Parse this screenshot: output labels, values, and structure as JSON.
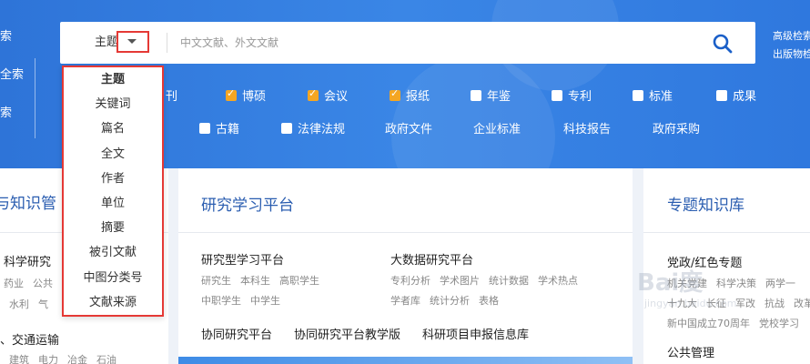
{
  "left_nav": [
    "索",
    "全索",
    "索"
  ],
  "search": {
    "field_label": "主题",
    "placeholder": "中文文献、外文文献",
    "icon": "search-icon"
  },
  "adv_links": [
    "高级检索",
    "出版物检索"
  ],
  "dropdown": {
    "options": [
      "主题",
      "关键词",
      "篇名",
      "全文",
      "作者",
      "单位",
      "摘要",
      "被引文献",
      "中图分类号",
      "文献来源"
    ],
    "selected": "主题"
  },
  "filters_row1": [
    {
      "label": "刊",
      "kind": "partial"
    },
    {
      "label": "博硕",
      "checked": true
    },
    {
      "label": "会议",
      "checked": true
    },
    {
      "label": "报纸",
      "checked": true
    },
    {
      "label": "年鉴",
      "checked": false
    },
    {
      "label": "专利",
      "checked": false
    },
    {
      "label": "标准",
      "checked": false
    },
    {
      "label": "成果",
      "checked": false
    }
  ],
  "filters_row2": [
    {
      "label": "古籍",
      "checked": false
    },
    {
      "label": "法律法规",
      "checked": false
    },
    {
      "label": "政府文件"
    },
    {
      "label": "企业标准"
    },
    {
      "label": "科技报告"
    },
    {
      "label": "政府采购"
    }
  ],
  "left_card": {
    "title": "与知识管",
    "section1": "科学研究",
    "tags1": [
      "药业",
      "公共"
    ],
    "tags2": [
      "水利",
      "气"
    ],
    "section2": "、交通运输",
    "tags3": [
      "建筑",
      "电力",
      "冶金",
      "石油"
    ]
  },
  "mid_card": {
    "title": "研究学习平台",
    "col1_title": "研究型学习平台",
    "col1_tags_a": [
      "研究生",
      "本科生",
      "高职学生"
    ],
    "col1_tags_b": [
      "中职学生",
      "中学生"
    ],
    "col2_title": "大数据研究平台",
    "col2_tags_a": [
      "专利分析",
      "学术图片",
      "统计数据",
      "学术热点"
    ],
    "col2_tags_b": [
      "学者库",
      "统计分析",
      "表格"
    ],
    "links": [
      "协同研究平台",
      "协同研究平台教学版",
      "科研项目申报信息库"
    ]
  },
  "right_card": {
    "title": "专题知识库",
    "section1": "党政/红色专题",
    "tags1": [
      "机关党建",
      "科学决策",
      "两学一"
    ],
    "tags2": [
      "十九大",
      "长征",
      "军改",
      "抗战",
      "改革"
    ],
    "tags3": [
      "新中国成立70周年",
      "党校学习"
    ],
    "section2": "公共管理"
  },
  "watermark": {
    "line1": "Bai度",
    "line2": "jingyan.baidu.com"
  }
}
